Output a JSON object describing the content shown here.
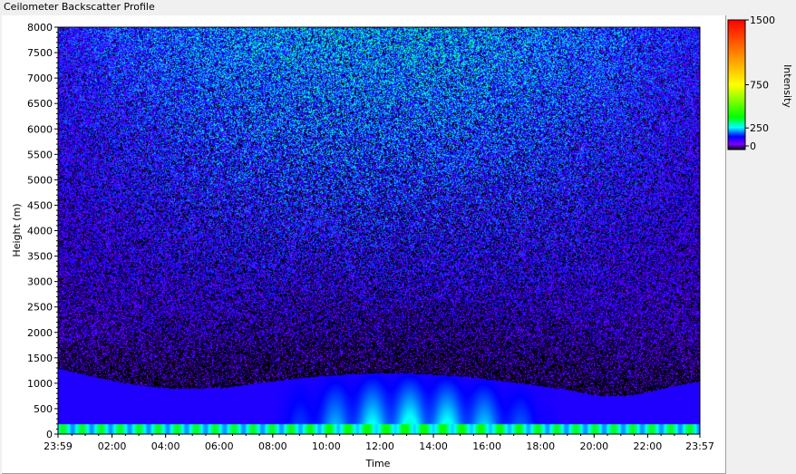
{
  "window_title": "Ceilometer Backscatter Profile",
  "chart_data": {
    "type": "heatmap",
    "title": "",
    "xlabel": "Time",
    "ylabel": "Height (m)",
    "x_ticks": [
      "23:59",
      "02:00",
      "04:00",
      "06:00",
      "08:00",
      "10:00",
      "12:00",
      "14:00",
      "16:00",
      "18:00",
      "20:00",
      "22:00",
      "23:57"
    ],
    "x_range": [
      "23:59",
      "23:57"
    ],
    "y_ticks": [
      0,
      500,
      1000,
      1500,
      2000,
      2500,
      3000,
      3500,
      4000,
      4500,
      5000,
      5500,
      6000,
      6500,
      7000,
      7500,
      8000
    ],
    "ylim": [
      0,
      8000
    ],
    "grid": false,
    "colorbar": {
      "label": "Intensity",
      "ticks": [
        0,
        250,
        750,
        1500
      ],
      "range": [
        0,
        1500
      ],
      "colors": [
        "#000000",
        "#7b00ff",
        "#0000ff",
        "#00ffff",
        "#00ff00",
        "#ffff00",
        "#ff0000"
      ]
    },
    "layers": [
      {
        "feature": "high-intensity near-surface band",
        "height_range": [
          0,
          200
        ],
        "approx_intensity": 260
      },
      {
        "feature": "boundary layer",
        "height_range": [
          200,
          1300
        ],
        "approx_intensity": 120
      },
      {
        "feature": "midday deep mixing",
        "time_range": [
          "09:00",
          "19:00"
        ],
        "height_range": [
          0,
          1300
        ],
        "approx_intensity": 200
      },
      {
        "feature": "upper-air noise",
        "height_range": [
          1300,
          8000
        ],
        "approx_intensity": 60
      }
    ]
  }
}
